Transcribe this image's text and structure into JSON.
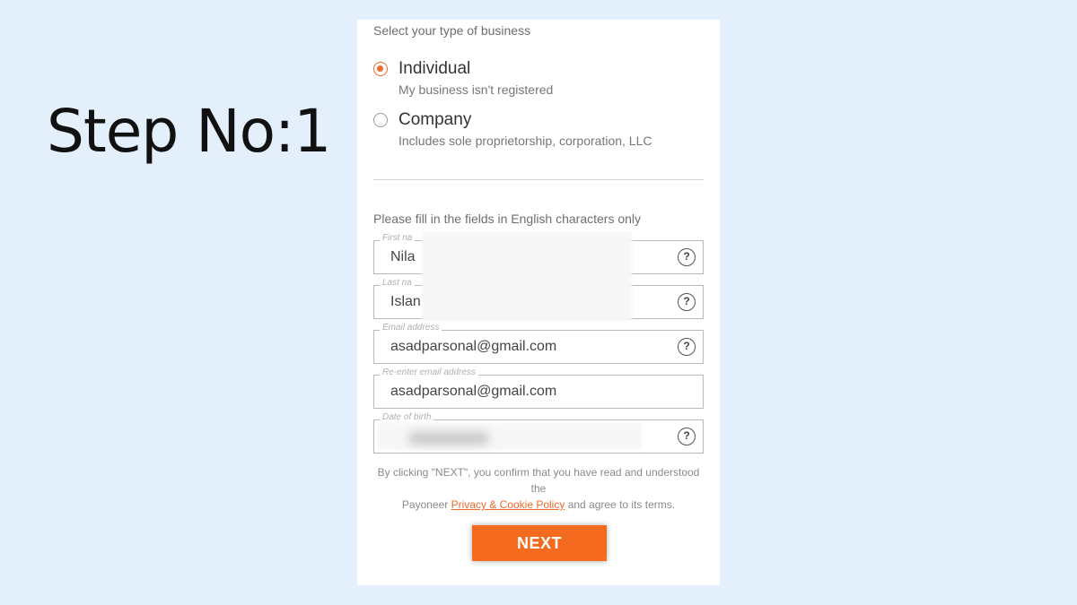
{
  "page": {
    "step_label": "Step No:1"
  },
  "business_type": {
    "title": "Select your type of business",
    "options": [
      {
        "label": "Individual",
        "sublabel": "My business isn't registered",
        "selected": true
      },
      {
        "label": "Company",
        "sublabel": "Includes sole proprietorship, corporation, LLC",
        "selected": false
      }
    ]
  },
  "form": {
    "note": "Please fill in the fields in English characters only",
    "fields": {
      "first_name": {
        "label": "First na",
        "value": "Nila"
      },
      "last_name": {
        "label": "Last na",
        "value": "Islan"
      },
      "email": {
        "label": "Email address",
        "value": "asadparsonal@gmail.com"
      },
      "reenter_email": {
        "label": "Re-enter email address",
        "value": "asadparsonal@gmail.com"
      },
      "dob": {
        "label": "Date of birth",
        "value": ""
      }
    },
    "help_glyph": "?"
  },
  "consent": {
    "line1": "By clicking \"NEXT\", you confirm that you have read and understood",
    "line2": "the",
    "prefix": "Payoneer",
    "link": "Privacy & Cookie Policy",
    "suffix": "and agree to its terms."
  },
  "next_button": {
    "label": "NEXT"
  },
  "colors": {
    "accent": "#f46a1e",
    "background": "#e3f0fb"
  }
}
